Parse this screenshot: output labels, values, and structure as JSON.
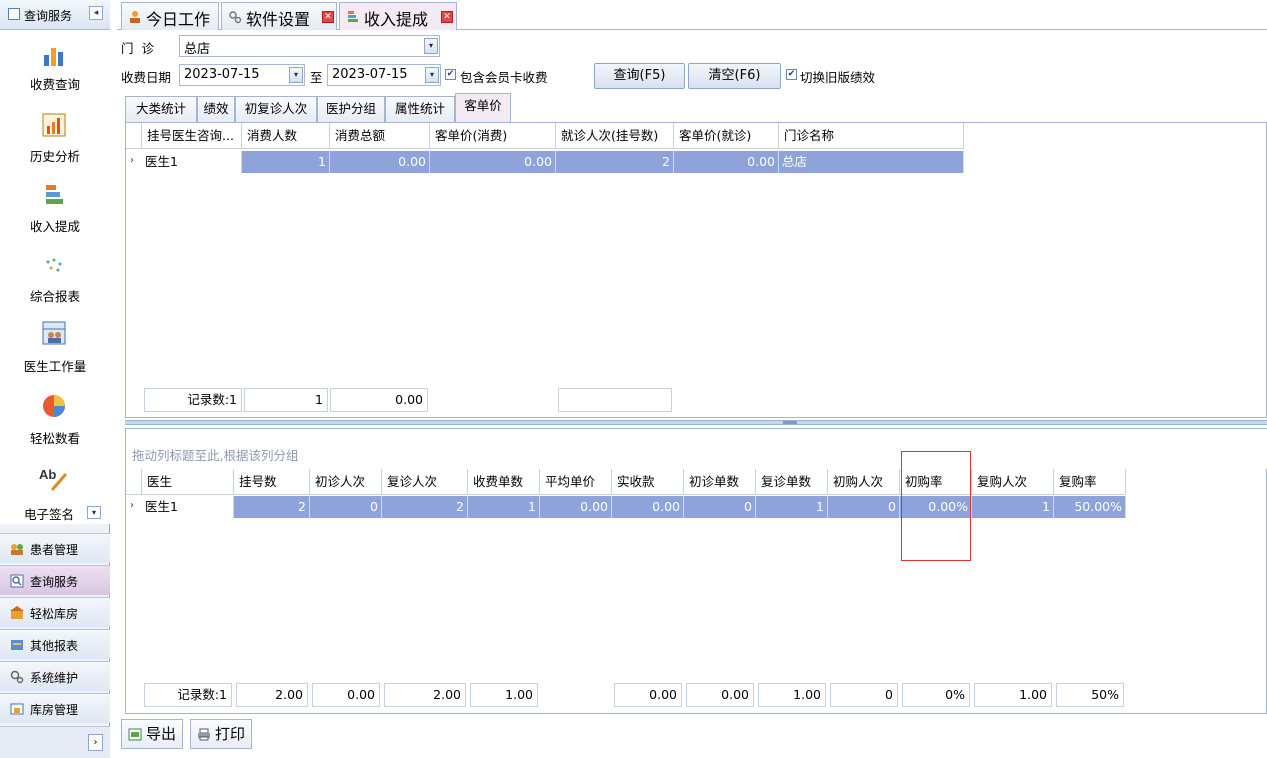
{
  "sidebar": {
    "header": "查询服务",
    "items": [
      {
        "label": "收费查询",
        "icon": "bar-chart-icon"
      },
      {
        "label": "历史分析",
        "icon": "history-chart-icon"
      },
      {
        "label": "收入提成",
        "icon": "stacked-bars-icon"
      },
      {
        "label": "综合报表",
        "icon": "scatter-dots-icon"
      },
      {
        "label": "医生工作量",
        "icon": "doctor-workload-icon"
      },
      {
        "label": "轻松数看",
        "icon": "pie-chart-icon"
      },
      {
        "label": "电子签名",
        "icon": "signature-icon"
      }
    ],
    "modules": [
      {
        "label": "患者管理",
        "icon": "patients-icon",
        "active": false
      },
      {
        "label": "查询服务",
        "icon": "search-icon",
        "active": true
      },
      {
        "label": "轻松库房",
        "icon": "warehouse-icon",
        "active": false
      },
      {
        "label": "其他报表",
        "icon": "report-icon",
        "active": false
      },
      {
        "label": "系统维护",
        "icon": "settings-icon",
        "active": false
      },
      {
        "label": "库房管理",
        "icon": "storeroom-icon",
        "active": false
      }
    ],
    "expand": "›"
  },
  "tabs": [
    {
      "label": "今日工作",
      "icon": "work-icon"
    },
    {
      "label": "软件设置",
      "icon": "gear-icon"
    },
    {
      "label": "收入提成",
      "icon": "stacked-bars-icon"
    }
  ],
  "filters": {
    "clinic_label": "门  诊",
    "clinic_value": "总店",
    "date_label": "收费日期",
    "date_from": "2023-07-15",
    "date_to_label": "至",
    "date_to": "2023-07-15",
    "include_member_label": "包含会员卡收费",
    "include_member_checked": "✔",
    "query_button": "查询(F5)",
    "clear_button": "清空(F6)",
    "old_perf_label": "切换旧版绩效",
    "old_perf_checked": "✔"
  },
  "subtabs": [
    "大类统计",
    "绩效",
    "初复诊人次",
    "医护分组",
    "属性统计",
    "客单价"
  ],
  "top_grid": {
    "columns": [
      "挂号医生咨询...",
      "消费人数",
      "消费总额",
      "客单价(消费)",
      "就诊人次(挂号数)",
      "客单价(就诊)",
      "门诊名称"
    ],
    "rows": [
      [
        "医生1",
        "1",
        "0.00",
        "0.00",
        "2",
        "0.00",
        "总店"
      ]
    ],
    "footer": {
      "count": "记录数:1",
      "persons": "1",
      "total": "0.00"
    }
  },
  "bottom_grid": {
    "group_hint": "拖动列标题至此,根据该列分组",
    "columns": [
      "医生",
      "挂号数",
      "初诊人次",
      "复诊人次",
      "收费单数",
      "平均单价",
      "实收款",
      "初诊单数",
      "复诊单数",
      "初购人次",
      "初购率",
      "复购人次",
      "复购率"
    ],
    "rows": [
      [
        "医生1",
        "2",
        "0",
        "2",
        "1",
        "0.00",
        "0.00",
        "0",
        "1",
        "0",
        "0.00%",
        "1",
        "50.00%"
      ]
    ],
    "footer": [
      "记录数:1",
      "2.00",
      "0.00",
      "2.00",
      "1.00",
      "",
      "0.00",
      "0.00",
      "1.00",
      "0",
      "0%",
      "1.00",
      "50%"
    ]
  },
  "toolbar": {
    "export": "导出",
    "print": "打印"
  },
  "colors": {
    "selection": "#8ea3d9",
    "highlight_box": "#e03030",
    "active_tab": "#f3eaf3"
  }
}
